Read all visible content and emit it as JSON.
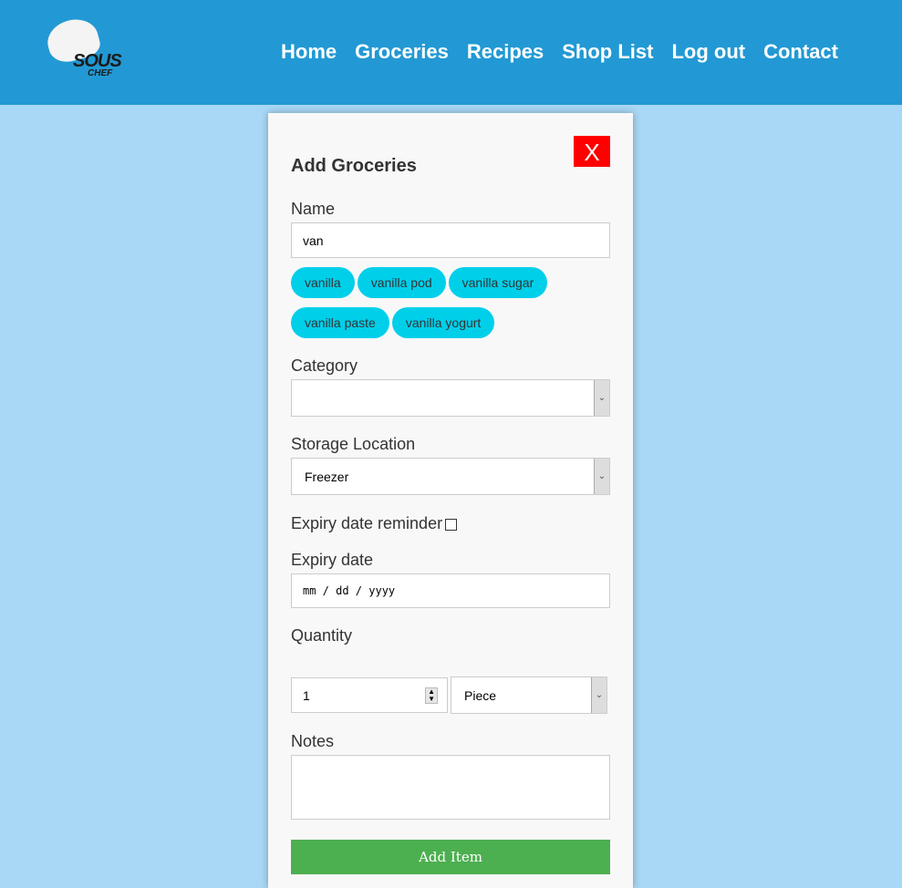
{
  "brand": {
    "line1": "SOUS",
    "line2": "CHEF"
  },
  "nav": [
    "Home",
    "Groceries",
    "Recipes",
    "Shop List",
    "Log out",
    "Contact"
  ],
  "modal": {
    "title": "Add Groceries",
    "close": "X",
    "name_label": "Name",
    "name_value": "van",
    "suggestions": [
      "vanilla",
      "vanilla pod",
      "vanilla sugar",
      "vanilla paste",
      "vanilla yogurt"
    ],
    "category_label": "Category",
    "category_value": "",
    "storage_label": "Storage Location",
    "storage_value": "Freezer",
    "expiry_reminder_label": "Expiry date reminder",
    "expiry_reminder_checked": false,
    "expiry_label": "Expiry date",
    "expiry_placeholder": "mm / dd / yyyy",
    "quantity_label": "Quantity",
    "quantity_value": "1",
    "unit_value": "Piece",
    "notes_label": "Notes",
    "notes_value": "",
    "submit": "Add Item"
  }
}
